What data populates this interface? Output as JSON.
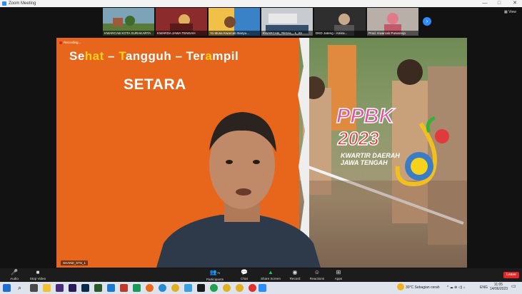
{
  "window": {
    "title": "Zoom Meeting",
    "controls": [
      "—",
      "□",
      "✕"
    ]
  },
  "gallery": {
    "next_icon": "›",
    "view_label": "View",
    "participants": [
      {
        "name": "KWARCAB KOTA SURAKARTA",
        "bg": "#5f7c8a"
      },
      {
        "name": "KWARDA JAWA TENGAH",
        "bg": "#8b2b2b"
      },
      {
        "name": "Yo Musa Kwarcab Banyu...",
        "bg": "#d07b2c"
      },
      {
        "name": "KWARCAB_TEGAL_ 1_23",
        "bg": "#36506b"
      },
      {
        "name": "DKD Jateng - Amira...",
        "bg": "#3d3d3d"
      },
      {
        "name": "Prod. Kwarcab Purworejo",
        "bg": "#9a7c77"
      }
    ]
  },
  "slide": {
    "recording_label": "Recording...",
    "slogan": [
      "Se",
      "hat",
      " – ",
      "T",
      "angguh",
      " – ",
      "Ter",
      "a",
      "mpil"
    ],
    "subtitle": "SETARA",
    "logo_text": "PPBK",
    "logo_year": "2023",
    "logo_org": [
      "KWARTIR DAERAH",
      "JAWA TENGAH"
    ],
    "speaker_name": "SHAND_STS_1"
  },
  "controls": {
    "audio": "Audio",
    "video": "Stop Video",
    "participants": "Participants",
    "participants_count": "70",
    "chat": "Chat",
    "share": "Share Screen",
    "record": "Record",
    "reactions": "Reactions",
    "apps": "Apps",
    "leave": "Leave"
  },
  "taskbar": {
    "weather": "30°C  Sebagian cerah",
    "lang": "ENG",
    "time": "11:05",
    "date": "14/06/2023"
  },
  "colors": {
    "accent": "#2d8cff",
    "leave": "#e02828",
    "slide_orange": "#e8661c",
    "slogan_yellow": "#f6d21c"
  }
}
